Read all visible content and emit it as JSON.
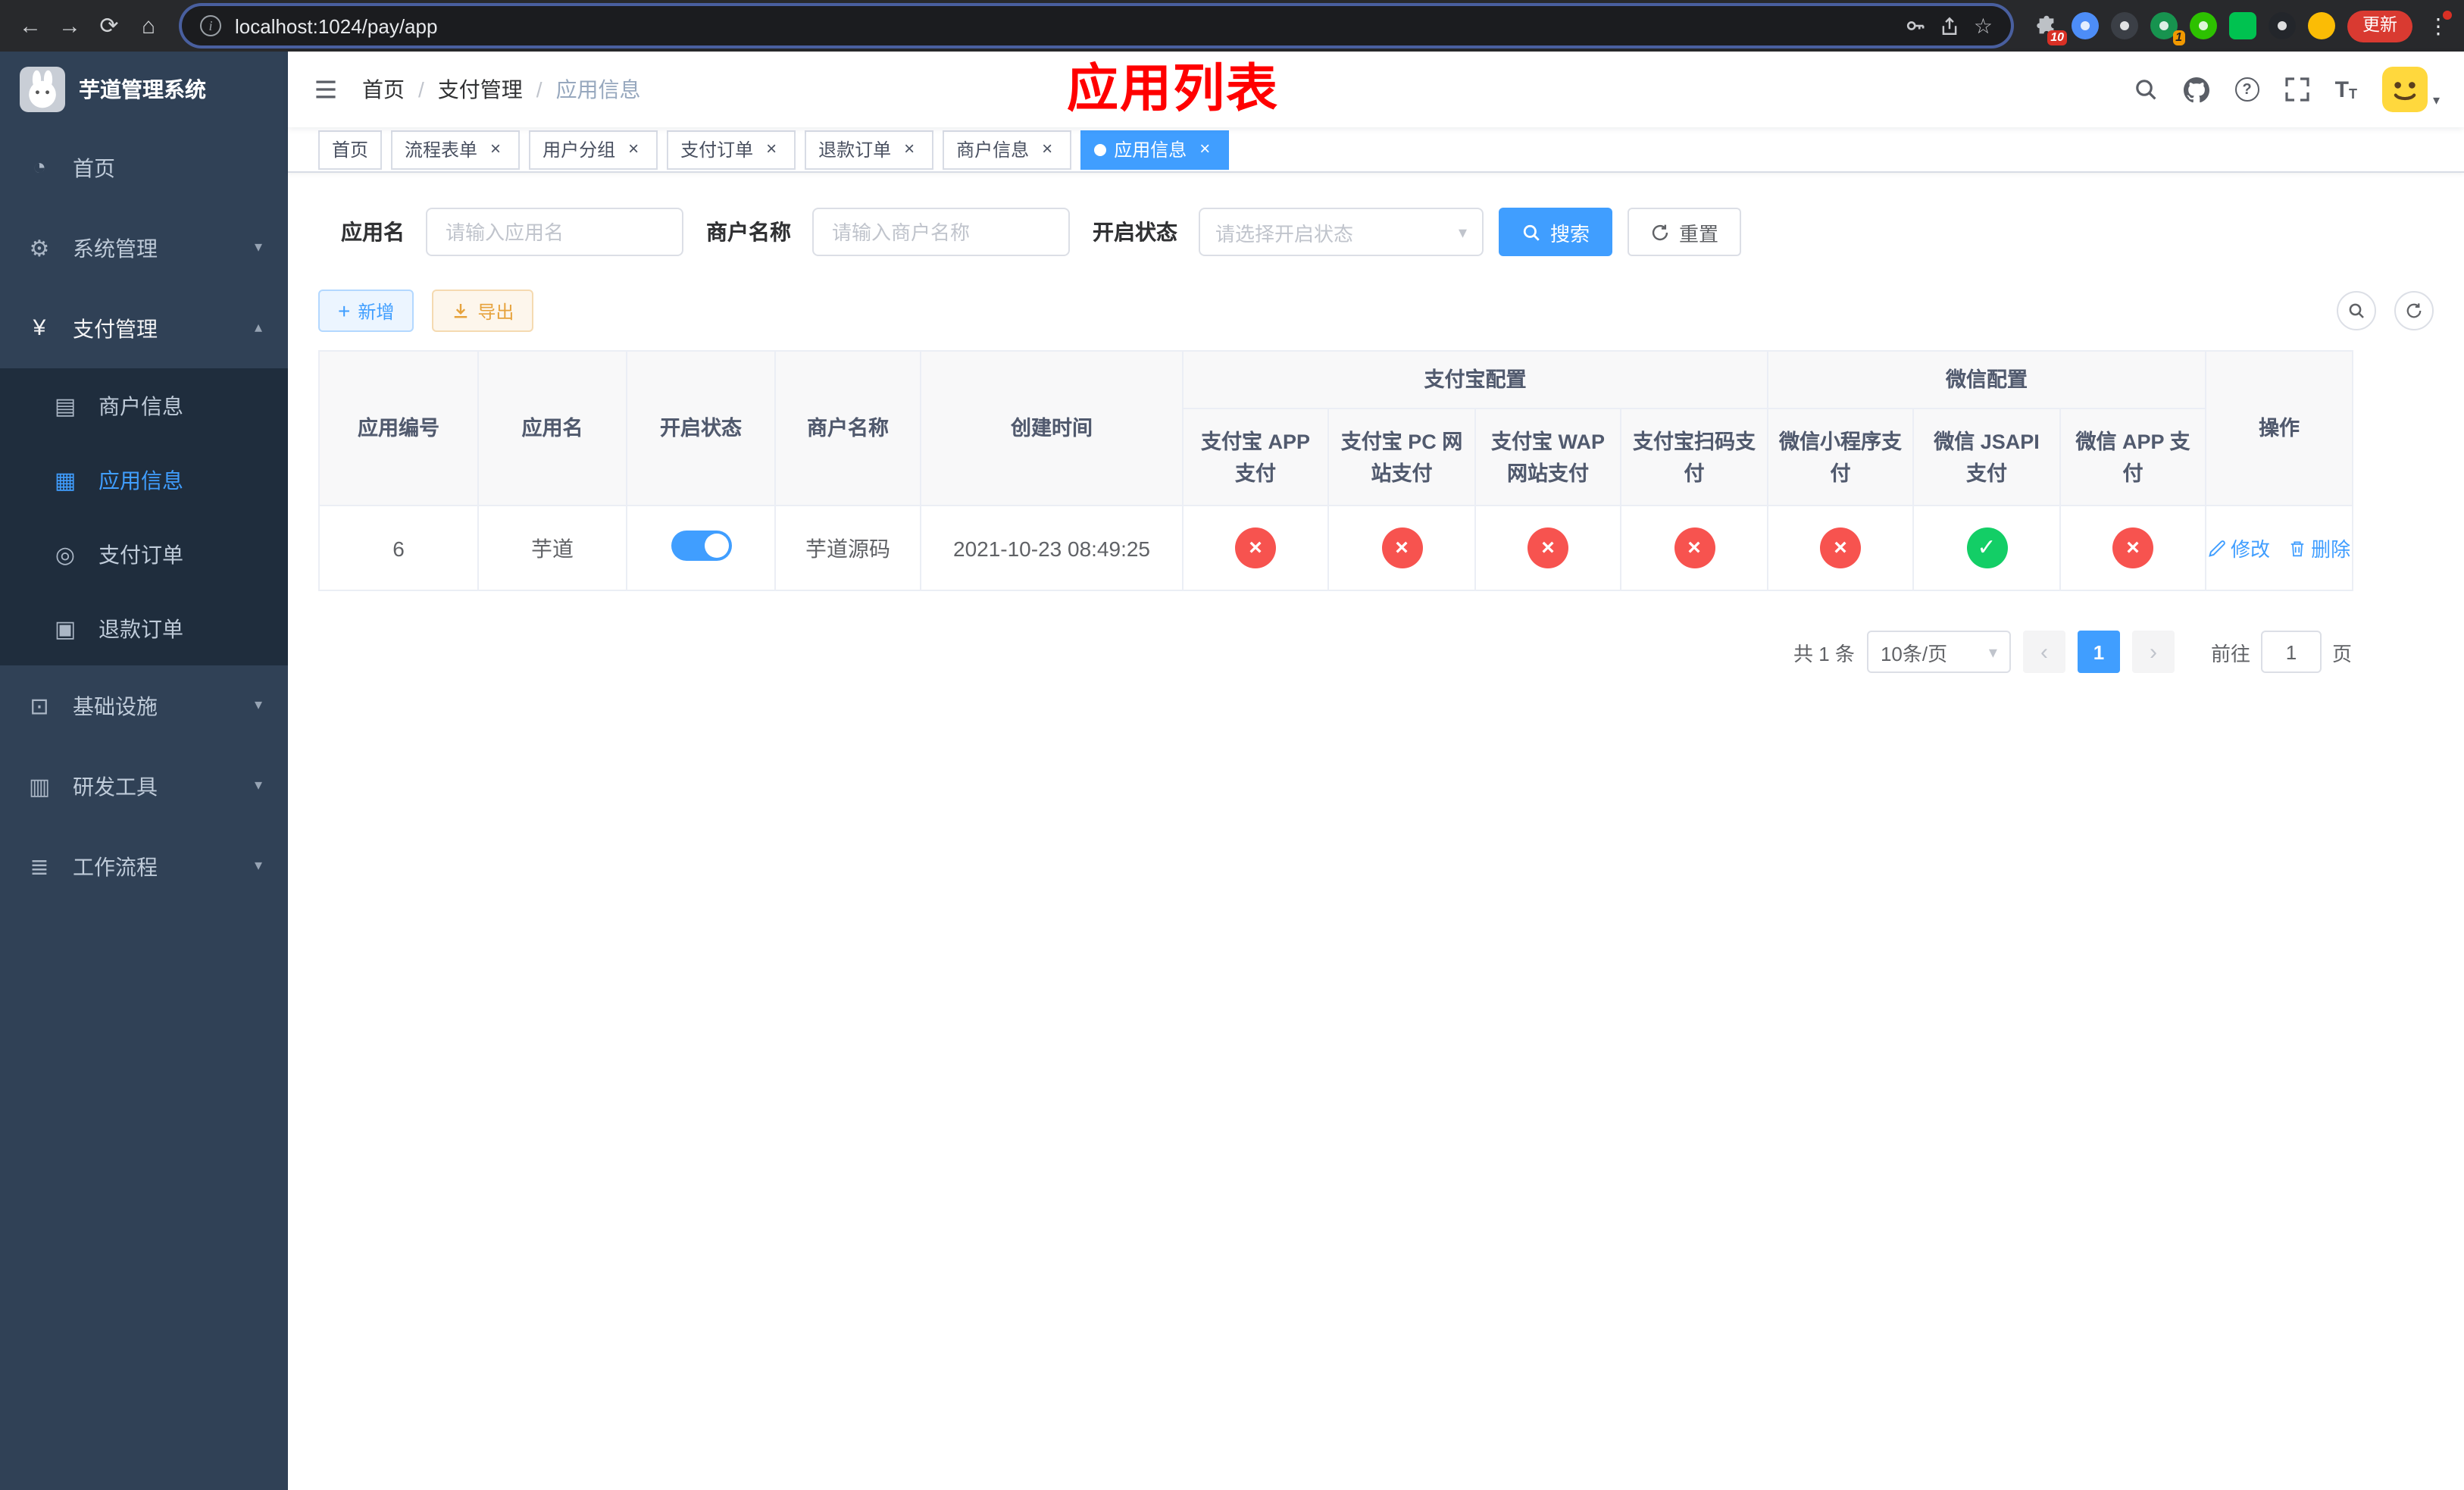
{
  "colors": {
    "accent": "#409eff",
    "success": "#13ce66",
    "danger": "#f7534f",
    "warning": "#e6a23c",
    "annotation_red": "#ff0000",
    "sidebar_bg": "#304156",
    "submenu_bg": "#1f2d3d"
  },
  "browser": {
    "url": "localhost:1024/pay/app",
    "update_label": "更新",
    "extensions_badge": "10",
    "extension_badge": "1"
  },
  "glyphs": {
    "back": "←",
    "forward": "→",
    "reload": "⟳",
    "home": "⌂",
    "info": "i",
    "star": "☆",
    "dots": "⋮",
    "close": "×",
    "chevron_down": "▾",
    "chevron_up": "▴",
    "check": "✓",
    "cross": "×",
    "plus": "+",
    "question": "?",
    "font_size": "T",
    "slash": "/",
    "prev": "‹",
    "next": "›",
    "caret": "▾"
  },
  "icons": {
    "dashboard": "◔",
    "gear": "⚙",
    "yen": "¥",
    "merchant": "▤",
    "app": "▦",
    "order": "◎",
    "refund": "▣",
    "infra": "⊡",
    "devtools": "▥",
    "workflow": "≣"
  },
  "sidebar": {
    "title": "芋道管理系统",
    "items": {
      "home": "首页",
      "system": "系统管理",
      "payment": "支付管理",
      "infra": "基础设施",
      "devtools": "研发工具",
      "workflow": "工作流程"
    },
    "payment_children": {
      "merchant": "商户信息",
      "app": "应用信息",
      "order": "支付订单",
      "refund": "退款订单"
    }
  },
  "header": {
    "breadcrumb": [
      "首页",
      "支付管理",
      "应用信息"
    ],
    "annotation_title": "应用列表"
  },
  "tabs": [
    {
      "label": "首页"
    },
    {
      "label": "流程表单"
    },
    {
      "label": "用户分组"
    },
    {
      "label": "支付订单"
    },
    {
      "label": "退款订单"
    },
    {
      "label": "商户信息"
    },
    {
      "label": "应用信息"
    }
  ],
  "filters": {
    "app_name_label": "应用名",
    "app_name_placeholder": "请输入应用名",
    "merchant_label": "商户名称",
    "merchant_placeholder": "请输入商户名称",
    "status_label": "开启状态",
    "status_placeholder": "请选择开启状态",
    "search_label": "搜索",
    "reset_label": "重置"
  },
  "toolbar": {
    "add_label": "新增",
    "export_label": "导出"
  },
  "table": {
    "headers": {
      "id": "应用编号",
      "name": "应用名",
      "status": "开启状态",
      "merchant": "商户名称",
      "created": "创建时间",
      "alipay_group": "支付宝配置",
      "wechat_group": "微信配置",
      "alipay_app": "支付宝 APP 支付",
      "alipay_pc": "支付宝 PC 网站支付",
      "alipay_wap": "支付宝 WAP 网站支付",
      "alipay_scan": "支付宝扫码支付",
      "wechat_mini": "微信小程序支付",
      "wechat_jsapi": "微信 JSAPI 支付",
      "wechat_app": "微信 APP 支付",
      "actions": "操作"
    },
    "row": {
      "id": "6",
      "name": "芋道",
      "enabled": true,
      "merchant": "芋道源码",
      "created": "2021-10-23 08:49:25",
      "alipay_app": "off",
      "alipay_pc": "off",
      "alipay_wap": "off",
      "alipay_scan": "off",
      "wechat_mini": "off",
      "wechat_jsapi": "on",
      "wechat_app": "off",
      "edit_label": "修改",
      "delete_label": "删除"
    }
  },
  "pagination": {
    "total": "共 1 条",
    "page_size": "10条/页",
    "page": "1",
    "goto_label": "前往",
    "goto_value": "1",
    "page_unit": "页"
  }
}
